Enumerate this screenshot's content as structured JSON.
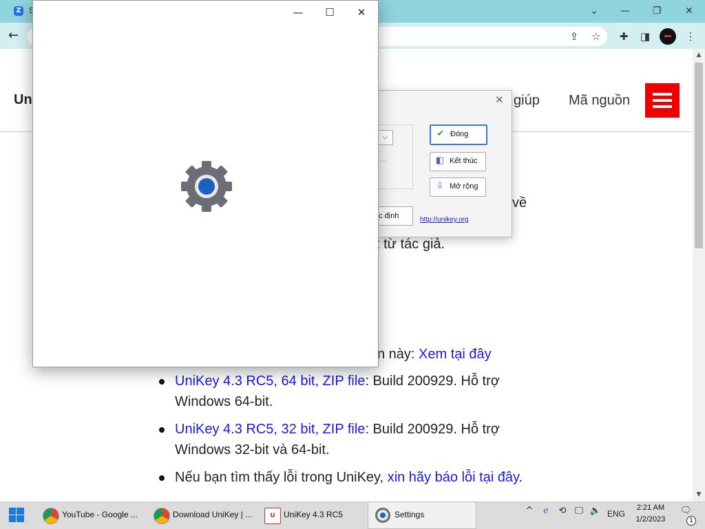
{
  "browser": {
    "tab_title": "S",
    "controls": {
      "dropdown": "⌄",
      "minimize": "—",
      "restore": "❐",
      "close": "✕"
    }
  },
  "site": {
    "logo_partial": "Un",
    "nav": [
      "giúp",
      "Mã nguồn"
    ],
    "fragments": {
      "ve": "về",
      "tac_gia": "t từ tác giả.",
      "phien_ban": "n này:",
      "xem_tai_day": "Xem tại đây"
    },
    "downloads": [
      {
        "link": "UniKey 4.3 RC5, 64 bit, ZIP file",
        "text": ": Build 200929. Hỗ trợ",
        "line2": "Windows 64-bit."
      },
      {
        "link": "UniKey 4.3 RC5, 32 bit, ZIP file",
        "text": ": Build 200929. Hỗ trợ",
        "line2": "Windows 32-bit và 64-bit."
      }
    ],
    "bug": {
      "text": "Nếu bạn tìm thấy lỗi trong UniKey,",
      "link": "xin hãy báo lỗi tại đây",
      "end": "."
    }
  },
  "unikey_dialog": {
    "buttons": {
      "close": "Đóng",
      "exit": "Kết thúc",
      "expand": "Mở rộng"
    },
    "partial_button": "c định",
    "link": "http://unikey.org",
    "combo_arrow": "⌵",
    "dots": "..."
  },
  "settings_window": {
    "controls": {
      "minimize": "—",
      "maximize": "☐",
      "close": "✕"
    }
  },
  "taskbar": {
    "items": [
      {
        "label": "YouTube - Google ..."
      },
      {
        "label": "Download UniKey | ..."
      },
      {
        "label": "UniKey 4.3 RC5"
      },
      {
        "label": "Settings"
      }
    ],
    "tray": {
      "language": "ENG"
    },
    "clock": {
      "time": "2:21 AM",
      "date": "1/2/2023"
    },
    "notification_count": "1"
  },
  "colors": {
    "link": "#1a1adb",
    "menu_red": "#e00000",
    "browser_frame": "#8fd3dc",
    "toolbar": "#d3eff2"
  }
}
